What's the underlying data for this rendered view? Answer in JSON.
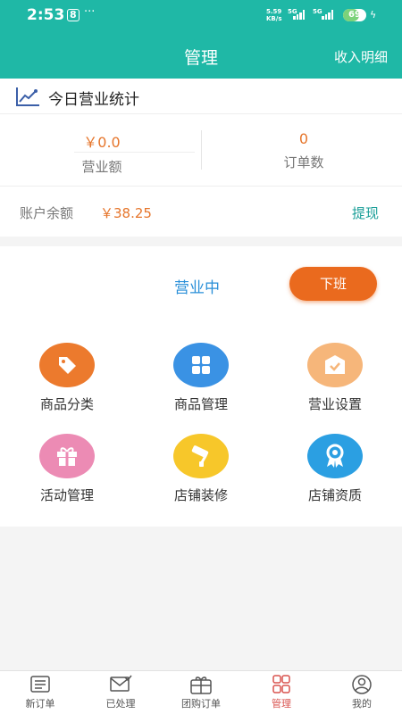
{
  "status_bar": {
    "time": "2:53",
    "app_badge": "8",
    "dots": "···",
    "net_speed_value": "5.59",
    "net_speed_unit": "KB/s",
    "network_1": "5G",
    "network_2": "5G",
    "battery": "69"
  },
  "header": {
    "title": "管理",
    "right_link": "收入明细"
  },
  "today_stats": {
    "title": "今日营业统计",
    "revenue_value": "￥0.0",
    "revenue_label": "营业额",
    "orders_value": "0",
    "orders_label": "订单数"
  },
  "balance": {
    "label": "账户余额",
    "value": "￥38.25",
    "action": "提现"
  },
  "business": {
    "status": "营业中",
    "toggle_label": "下班"
  },
  "tiles": [
    {
      "label": "商品分类",
      "icon": "price-tag-icon",
      "color": "#ec7a2d"
    },
    {
      "label": "商品管理",
      "icon": "grid-icon",
      "color": "#3a92e4"
    },
    {
      "label": "营业设置",
      "icon": "shop-settings-icon",
      "color": "#f6b67a"
    },
    {
      "label": "活动管理",
      "icon": "gift-icon",
      "color": "#ec8bb4"
    },
    {
      "label": "店铺装修",
      "icon": "paint-roller-icon",
      "color": "#f7c72a"
    },
    {
      "label": "店铺资质",
      "icon": "award-ribbon-icon",
      "color": "#2b9fe2"
    }
  ],
  "tab_bar": [
    {
      "label": "新订单",
      "icon": "order-list-icon"
    },
    {
      "label": "已处理",
      "icon": "mail-check-icon"
    },
    {
      "label": "团购订单",
      "icon": "gift-box-icon"
    },
    {
      "label": "管理",
      "icon": "four-squares-icon",
      "active": true
    },
    {
      "label": "我的",
      "icon": "user-profile-icon"
    }
  ],
  "colors": {
    "primary": "#1fb8a6",
    "accent_orange": "#e6762c",
    "status_blue": "#2a8fd8",
    "active_tab": "#d9534f"
  }
}
